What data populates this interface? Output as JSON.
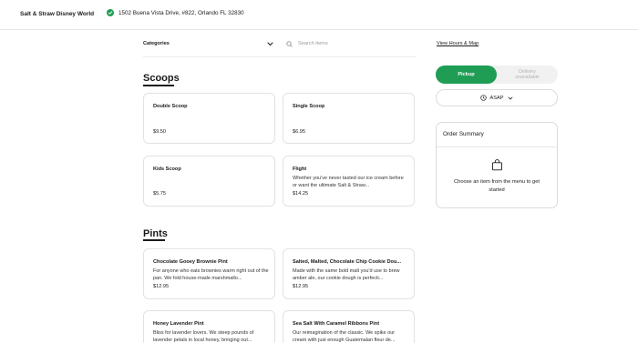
{
  "header": {
    "store_name": "Salt & Straw Disney World",
    "address": "1502 Buena Vista Drive, #822, Orlando FL 32830"
  },
  "filters": {
    "categories_label": "Categories",
    "search_placeholder": "Search items"
  },
  "sections": {
    "scoops": {
      "title": "Scoops",
      "items": [
        {
          "name": "Double Scoop",
          "description": "",
          "price": "$9.50"
        },
        {
          "name": "Single Scoop",
          "description": "",
          "price": "$6.95"
        },
        {
          "name": "Kids Scoop",
          "description": "",
          "price": "$5.75"
        },
        {
          "name": "Flight",
          "description": "Whether you've never tasted our ice cream before or want the ultimate Salt & Straw...",
          "price": "$14.25"
        }
      ]
    },
    "pints": {
      "title": "Pints",
      "items": [
        {
          "name": "Chocolate Gooey Brownie Pint",
          "description": "For anyone who eats brownies warm right out of the pan. We fold house-made marshmallo...",
          "price": "$12.95"
        },
        {
          "name": "Salted, Malted, Chocolate Chip Cookie Dou...",
          "description": "Made with the same bold malt you'd use to brew amber ale, our cookie dough is perfecti...",
          "price": "$12.95"
        },
        {
          "name": "Honey Lavender Pint",
          "description": "Bliss for lavender lovers. We steep pounds of lavender petals in local honey, bringing out...",
          "price": ""
        },
        {
          "name": "Sea Salt With Caramel Ribbons Pint",
          "description": "Our reimagination of the classic. We spike our cream with just enough Guatemalan fleur de...",
          "price": ""
        }
      ]
    }
  },
  "sidebar": {
    "hours_link": "View Hours & Map",
    "pickup_label": "Pickup",
    "delivery_label_1": "Delivery",
    "delivery_label_2": "unavailable",
    "time_label": "ASAP",
    "order_summary_title": "Order Summary",
    "empty_message": "Choose an item from the menu to get started"
  },
  "colors": {
    "accent": "#1f9d55",
    "border": "#e2e2e2"
  }
}
